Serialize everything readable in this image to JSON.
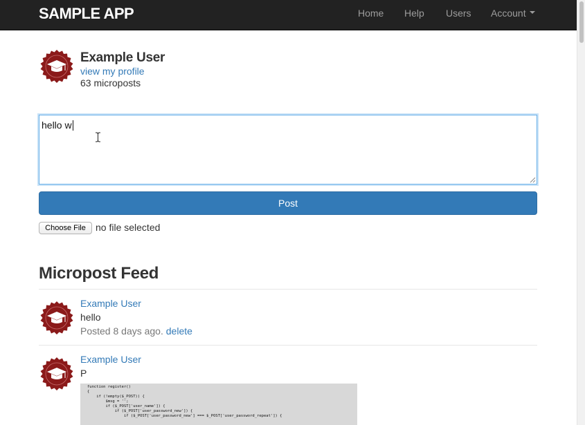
{
  "navbar": {
    "brand": "SAMPLE APP",
    "links": [
      "Home",
      "Help",
      "Users"
    ],
    "account_label": "Account"
  },
  "user_info": {
    "name": "Example User",
    "profile_link": "view my profile",
    "micropost_count": "63 microposts"
  },
  "composer": {
    "content": "hello w",
    "post_label": "Post",
    "file_button": "Choose File",
    "file_status": "no file selected"
  },
  "feed": {
    "title": "Micropost Feed",
    "posts": [
      {
        "user": "Example User",
        "content": "hello",
        "timestamp": "Posted 8 days ago.",
        "delete_label": "delete"
      },
      {
        "user": "Example User",
        "content": "P",
        "image_code": "function register()\n{\n    if (!empty($_POST)) {\n        $msg = '';\n        if ($_POST['user_name']) {\n            if ($_POST['user_password_new']) {\n                if ($_POST['user_password_new'] === $_POST['user_password_repeat']) {"
      }
    ]
  },
  "colors": {
    "navbar_bg": "#222222",
    "link": "#337ab7",
    "primary_button": "#337ab7",
    "avatar_badge": "#8b1a1a"
  },
  "icons": {
    "avatar": "graduation-cap-badge-icon",
    "caret": "caret-down-icon"
  }
}
